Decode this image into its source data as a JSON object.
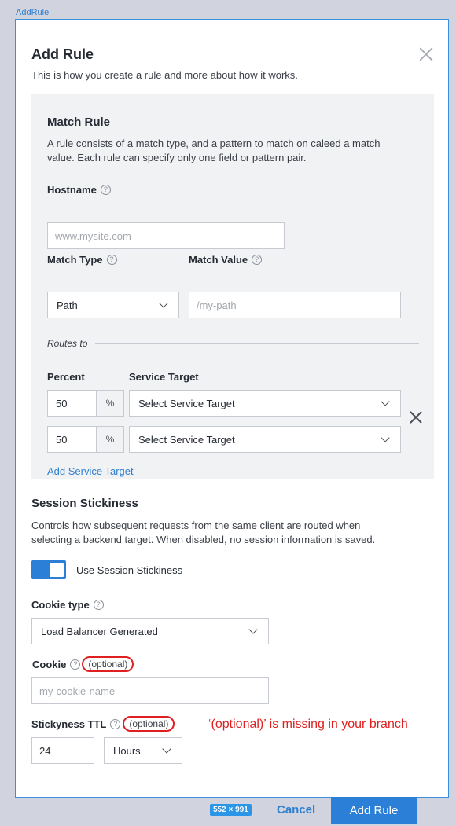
{
  "frame_label": "AddRule",
  "modal": {
    "title": "Add Rule",
    "subtitle": "This is how you create a rule and more about how it works.",
    "close_icon": "close-icon"
  },
  "match_rule": {
    "heading": "Match Rule",
    "description_line1": "A rule consists of a match type, and a pattern to match on caleed a match",
    "description_line2": "value. Each rule can specify only one field or pattern pair.",
    "hostname_label": "Hostname",
    "hostname_placeholder": "www.mysite.com",
    "match_type_label": "Match Type",
    "match_type_value": "Path",
    "match_value_label": "Match Value",
    "match_value_placeholder": "/my-path",
    "help_glyph": "?"
  },
  "routes": {
    "label": "Routes to",
    "percent_header": "Percent",
    "target_header": "Service Target",
    "rows": [
      {
        "percent": "50",
        "unit": "%",
        "target": "Select Service Target"
      },
      {
        "percent": "50",
        "unit": "%",
        "target": "Select Service Target"
      }
    ],
    "add_link": "Add Service Target"
  },
  "session": {
    "heading": "Session Stickiness",
    "description_line1": "Controls how subsequent requests from the same client are routed when",
    "description_line2": "selecting a backend target. When disabled, no session information is saved.",
    "toggle_label": "Use Session Stickiness",
    "toggle_on": true,
    "cookie_type_label": "Cookie type",
    "cookie_type_value": "Load Balancer Generated",
    "cookie_label": "Cookie",
    "optional_text": "(optional)",
    "cookie_placeholder": "my-cookie-name",
    "ttl_label": "Stickyness TTL",
    "ttl_value": "24",
    "ttl_unit": "Hours"
  },
  "annotation": "‘(optional)’ is missing in your branch",
  "size_badge": "552 × 991",
  "footer": {
    "cancel_label": "Cancel",
    "submit_label": "Add Rule"
  },
  "colors": {
    "primary": "#2b7fd6",
    "annotation_red": "#e02020",
    "panel_bg": "#f1f2f4"
  }
}
